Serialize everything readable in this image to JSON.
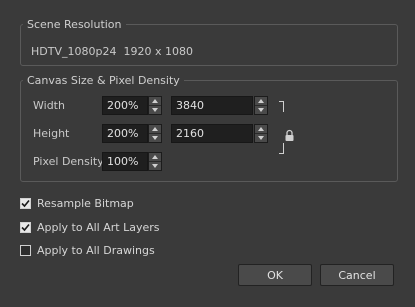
{
  "scene_resolution": {
    "legend": "Scene Resolution",
    "preset": "HDTV_1080p24",
    "dimensions": "1920 x 1080"
  },
  "canvas": {
    "legend": "Canvas Size & Pixel Density",
    "width": {
      "label": "Width",
      "percent": "200%",
      "pixels": "3840"
    },
    "height": {
      "label": "Height",
      "percent": "200%",
      "pixels": "2160"
    },
    "pixel_density": {
      "label": "Pixel Density",
      "percent": "100%"
    },
    "lock_icon": "lock-icon"
  },
  "options": [
    {
      "label": "Resample Bitmap",
      "checked": true
    },
    {
      "label": "Apply to All Art Layers",
      "checked": true
    },
    {
      "label": "Apply to All Drawings",
      "checked": false
    }
  ],
  "buttons": {
    "ok": "OK",
    "cancel": "Cancel"
  },
  "colors": {
    "background": "#3a3a3a",
    "field": "#1f1f1f",
    "text": "#d6d6d6"
  }
}
